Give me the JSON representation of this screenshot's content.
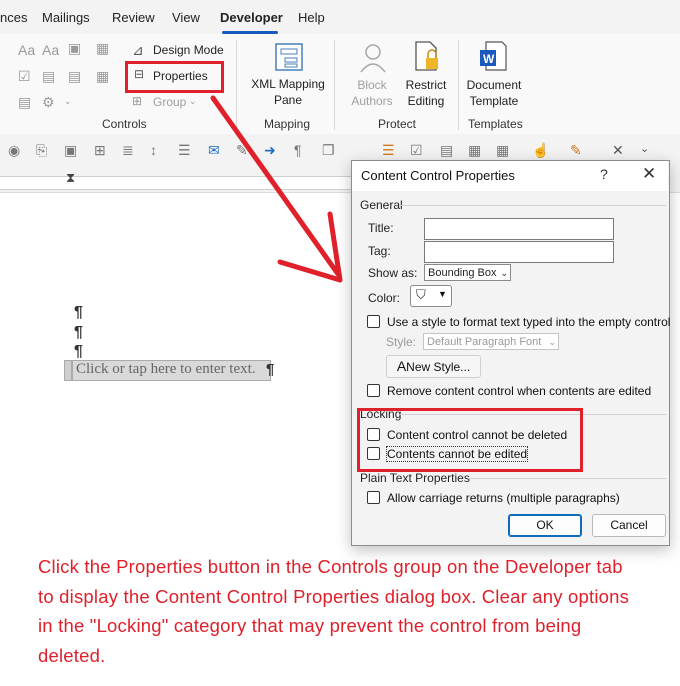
{
  "tabs": [
    "nces",
    "Mailings",
    "Review",
    "View",
    "Developer",
    "Help"
  ],
  "ribbon": {
    "controls": {
      "design_mode": "Design Mode",
      "properties": "Properties",
      "group": "Group",
      "label": "Controls"
    },
    "mapping": {
      "xml_line1": "XML Mapping",
      "xml_line2": "Pane",
      "label": "Mapping"
    },
    "protect": {
      "block_line1": "Block",
      "block_line2": "Authors",
      "restrict_line1": "Restrict",
      "restrict_line2": "Editing",
      "label": "Protect"
    },
    "templates": {
      "doc_line1": "Document",
      "doc_line2": "Template",
      "label": "Templates"
    }
  },
  "document": {
    "pilcrow": "¶",
    "placeholder": "Click or tap here to enter text."
  },
  "dialog": {
    "title": "Content Control Properties",
    "help": "?",
    "close": "✕",
    "general": "General",
    "title_label": "Title:",
    "tag_label": "Tag:",
    "show_as_label": "Show as:",
    "show_as_value": "Bounding Box",
    "color_label": "Color:",
    "use_style": "Use a style to format text typed into the empty control",
    "style_label": "Style:",
    "style_value": "Default Paragraph Font",
    "new_style": "New Style...",
    "remove_control": "Remove content control when contents are edited",
    "locking": "Locking",
    "cannot_delete": "Content control cannot be deleted",
    "cannot_edit": "Contents cannot be edited",
    "plain_text": "Plain Text Properties",
    "allow_returns": "Allow carriage returns (multiple paragraphs)",
    "ok": "OK",
    "cancel": "Cancel"
  },
  "caption": "Click  the Properties button in the Controls group on the Developer tab to display the  Content Control Properties dialog box. Clear any options in the \"Locking\" category that may prevent the control from being deleted.",
  "colors": {
    "accent": "#185abd",
    "annotation_red": "#e0202a"
  }
}
